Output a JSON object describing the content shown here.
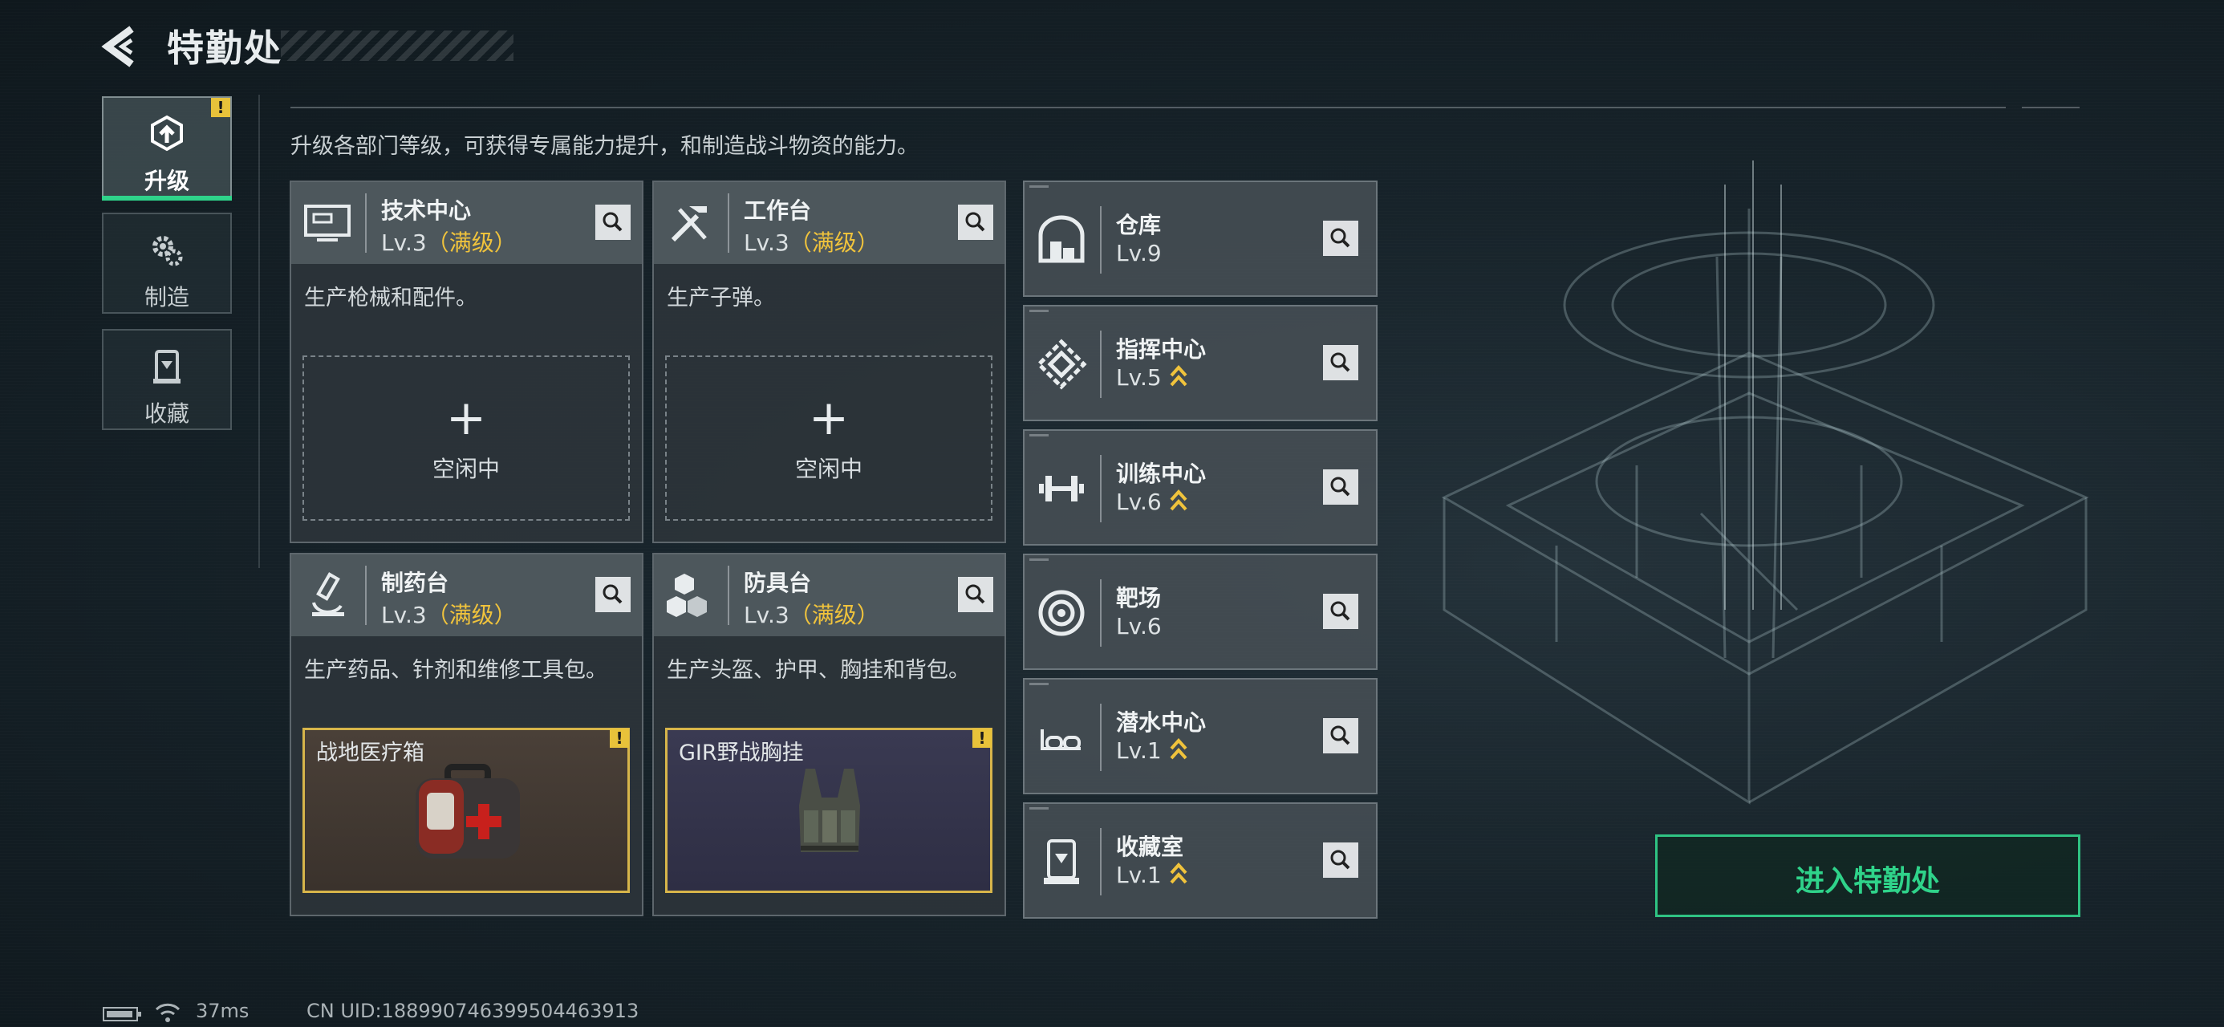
{
  "header": {
    "title": "特勤处"
  },
  "nav": {
    "items": [
      {
        "label": "升级",
        "icon": "upgrade-icon",
        "active": true
      },
      {
        "label": "制造",
        "icon": "gears-icon",
        "active": false
      },
      {
        "label": "收藏",
        "icon": "collection-icon",
        "active": false
      }
    ]
  },
  "main": {
    "description": "升级各部门等级，可获得专属能力提升，和制造战斗物资的能力。",
    "production_cards": [
      {
        "name": "技术中心",
        "level": "Lv.3",
        "max": "（满级）",
        "desc": "生产枪械和配件。",
        "slot": {
          "plus": "+",
          "text": "空闲中"
        },
        "icon": "computer-icon"
      },
      {
        "name": "工作台",
        "level": "Lv.3",
        "max": "（满级）",
        "desc": "生产子弹。",
        "slot": {
          "plus": "+",
          "text": "空闲中"
        },
        "icon": "tools-icon"
      },
      {
        "name": "制药台",
        "level": "Lv.3",
        "max": "（满级）",
        "desc": "生产药品、针剂和维修工具包。",
        "item": {
          "name": "战地医疗箱",
          "alert": "!"
        },
        "icon": "microscope-icon"
      },
      {
        "name": "防具台",
        "level": "Lv.3",
        "max": "（满级）",
        "desc": "生产头盔、护甲、胸挂和背包。",
        "item": {
          "name": "GIR野战胸挂",
          "alert": "!"
        },
        "icon": "armor-icon"
      }
    ],
    "facilities": [
      {
        "name": "仓库",
        "level": "Lv.9",
        "upgradable": false,
        "icon": "warehouse-icon"
      },
      {
        "name": "指挥中心",
        "level": "Lv.5",
        "upgradable": true,
        "icon": "command-icon"
      },
      {
        "name": "训练中心",
        "level": "Lv.6",
        "upgradable": true,
        "icon": "dumbbell-icon"
      },
      {
        "name": "靶场",
        "level": "Lv.6",
        "upgradable": false,
        "icon": "target-icon"
      },
      {
        "name": "潜水中心",
        "level": "Lv.1",
        "upgradable": true,
        "icon": "diving-mask-icon"
      },
      {
        "name": "收藏室",
        "level": "Lv.1",
        "upgradable": true,
        "icon": "collection-room-icon"
      }
    ]
  },
  "enter_button": {
    "label": "进入特勤处"
  },
  "footer": {
    "ping": "37ms",
    "uid": "CN UID:18899074639950446391​3"
  },
  "colors": {
    "accent_green": "#2fd38a",
    "max_gold": "#f0c33c",
    "alert_yellow": "#e8c23a"
  }
}
